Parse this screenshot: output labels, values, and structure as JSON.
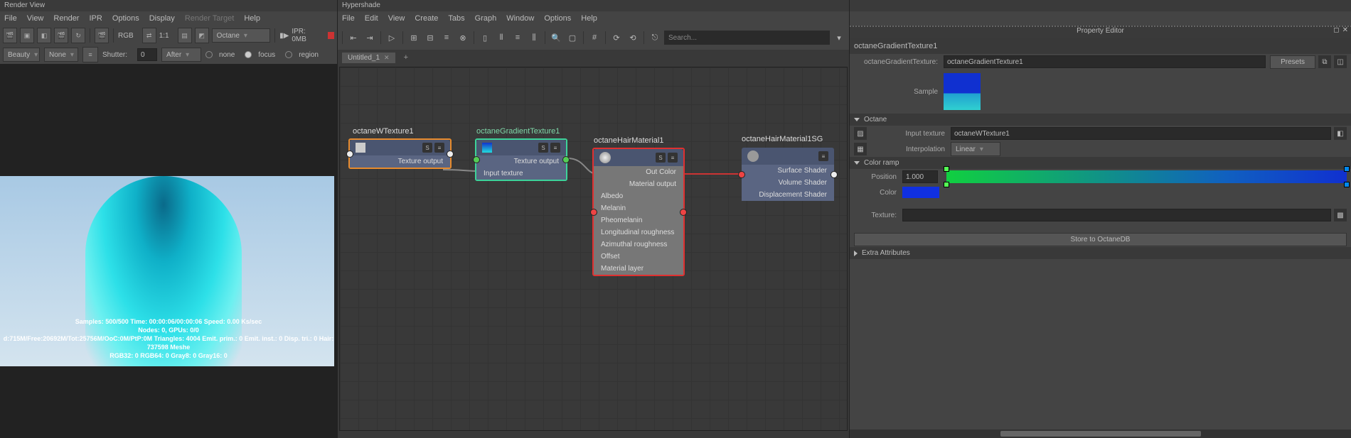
{
  "renderView": {
    "title": "Render View",
    "menu": [
      "File",
      "View",
      "Render",
      "IPR",
      "Options",
      "Display",
      "Render Target",
      "Help"
    ],
    "row1": {
      "rgb": "RGB",
      "ratio": "1:1",
      "renderer": "Octane",
      "play_icon": "▮▶",
      "ipr": "IPR: 0MB"
    },
    "row2": {
      "beauty": "Beauty",
      "none": "None",
      "shutter": "Shutter:",
      "shutter_val": "0",
      "after": "After",
      "modes": [
        "none",
        "focus",
        "region"
      ]
    },
    "stats": {
      "l1": "Samples: 500/500  Time: 00:00:06/00:00:06  Speed: 0.00 Ks/sec",
      "l2": "Nodes: 0, GPUs: 0/0",
      "l3": "d:715M/Free:20692M/Tot:25756M/OoC:0M/PtP:0M  Triangles: 4004 Emit. prim.: 0 Emit. inst.: 0 Disp. tri.: 0 Hair: 737598 Meshe",
      "l4": "RGB32: 0 RGB64: 0 Gray8: 0 Gray16: 0"
    }
  },
  "hypershade": {
    "title": "Hypershade",
    "menu": [
      "File",
      "Edit",
      "View",
      "Create",
      "Tabs",
      "Graph",
      "Window",
      "Options",
      "Help"
    ],
    "search_ph": "Search...",
    "tab": "Untitled_1",
    "nodes": {
      "wtex": {
        "title": "octaneWTexture1",
        "out": "Texture output"
      },
      "grad": {
        "title": "octaneGradientTexture1",
        "out": "Texture output",
        "in": "Input texture"
      },
      "hair": {
        "title": "octaneHairMaterial1",
        "rows": [
          "Out Color",
          "Material output",
          "Albedo",
          "Melanin",
          "Pheomelanin",
          "Longitudinal roughness",
          "Azimuthal roughness",
          "Offset",
          "Material layer"
        ]
      },
      "sg": {
        "title": "octaneHairMaterial1SG",
        "rows": [
          "Surface Shader",
          "Volume Shader",
          "Displacement Shader"
        ]
      }
    }
  },
  "propEditor": {
    "title": "Property Editor",
    "node_name": "octaneGradientTexture1",
    "type_label": "octaneGradientTexture:",
    "type_val": "octaneGradientTexture1",
    "presets": "Presets",
    "sample": "Sample",
    "sections": {
      "octane": "Octane",
      "input_tex_lbl": "Input texture",
      "input_tex_val": "octaneWTexture1",
      "interp_lbl": "Interpolation",
      "interp_val": "Linear",
      "ramp": "Color ramp",
      "pos_lbl": "Position",
      "pos_val": "1.000",
      "color_lbl": "Color",
      "texture_lbl": "Texture:",
      "store": "Store to OctaneDB",
      "extra": "Extra Attributes"
    }
  }
}
